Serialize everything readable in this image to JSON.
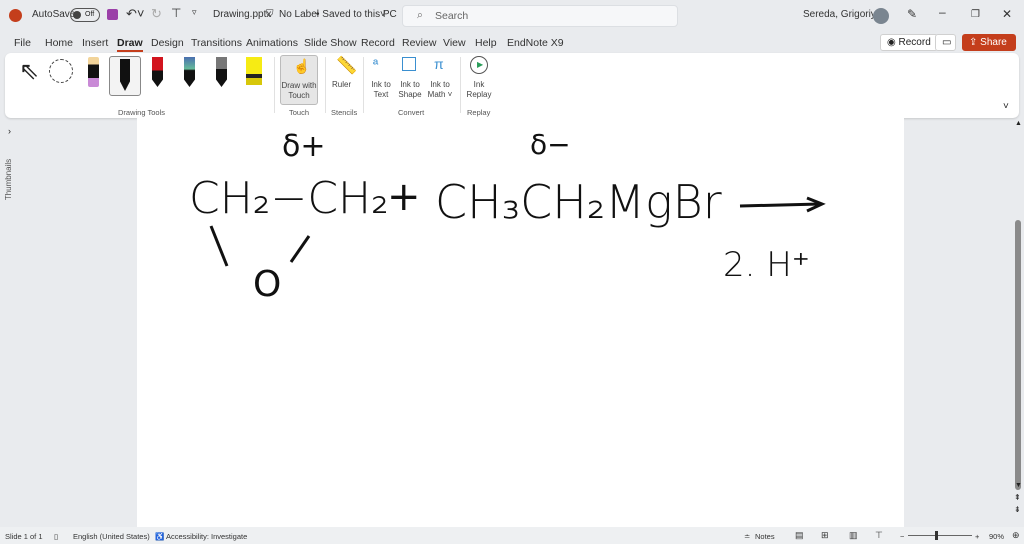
{
  "titlebar": {
    "autosave": "AutoSave",
    "toggle": "Off",
    "filename": "Drawing.pptx",
    "label": "No Label",
    "saved": "• Saved to this PC",
    "search_placeholder": "Search",
    "user": "Sereda, Grigoriy A"
  },
  "tabs": [
    "File",
    "Home",
    "Insert",
    "Draw",
    "Design",
    "Transitions",
    "Animations",
    "Slide Show",
    "Record",
    "Review",
    "View",
    "Help",
    "EndNote X9"
  ],
  "actions": {
    "record": "Record",
    "share": "Share"
  },
  "ribbon": {
    "groups": {
      "drawing_tools": "Drawing Tools",
      "touch": "Touch",
      "stencils": "Stencils",
      "convert": "Convert",
      "replay": "Replay"
    },
    "buttons": {
      "draw_touch_1": "Draw with",
      "draw_touch_2": "Touch",
      "ruler": "Ruler",
      "ink_text_1": "Ink to",
      "ink_text_2": "Text",
      "ink_shape_1": "Ink to",
      "ink_shape_2": "Shape",
      "ink_math_1": "Ink to",
      "ink_math_2": "Math ˅",
      "ink_replay_1": "Ink",
      "ink_replay_2": "Replay"
    }
  },
  "thumbnails_label": "Thumbnails",
  "ink": {
    "delta_plus": "δ+",
    "delta_minus": "δ−",
    "reactant1": "CH₂−CH₂",
    "plus": "+",
    "reactant2": "CH₃CH₂MgBr",
    "epoxide_o": "O",
    "reagent": "2. H⁺"
  },
  "status": {
    "slide": "Slide 1 of 1",
    "language": "English (United States)",
    "accessibility": "Accessibility: Investigate",
    "notes": "Notes",
    "zoom": "90%"
  },
  "colors": {
    "accent": "#c43e1c",
    "share": "#c43e1c"
  }
}
